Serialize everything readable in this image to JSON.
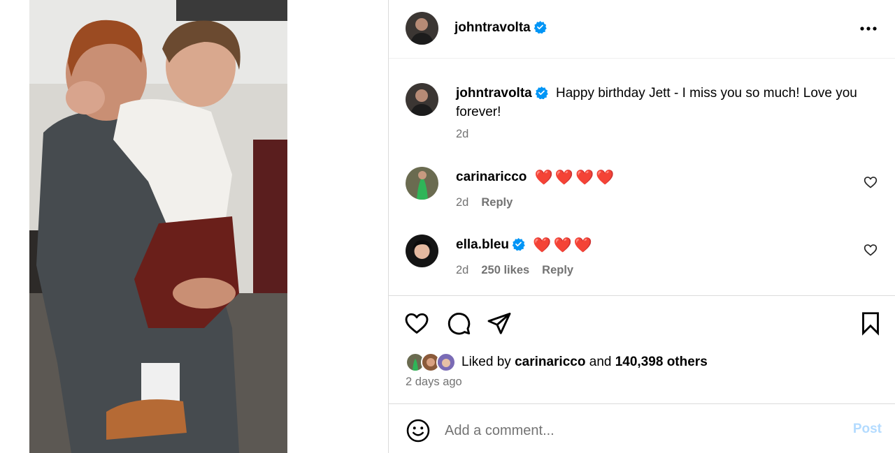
{
  "post": {
    "author": "johntravolta",
    "caption": "Happy birthday Jett - I miss you so much! Love you forever!",
    "time": "2d"
  },
  "comments": [
    {
      "username": "carinaricco",
      "text": "❤️❤️❤️❤️",
      "time": "2d",
      "likes": "",
      "reply": "Reply",
      "verified": false
    },
    {
      "username": "ella.bleu",
      "text": "❤️❤️❤️",
      "time": "2d",
      "likes": "250 likes",
      "reply": "Reply",
      "verified": true
    }
  ],
  "likes": {
    "prefix": "Liked by",
    "user": "carinaricco",
    "and": "and",
    "others": "140,398 others"
  },
  "date_label": "2 days ago",
  "composer": {
    "placeholder": "Add a comment...",
    "post_label": "Post"
  },
  "colors": {
    "verified": "#0095f6",
    "post_disabled": "#b3dbff",
    "meta": "#737373",
    "heart_emoji": "#e0182f"
  },
  "icons": [
    "verified-badge-icon",
    "more-options-icon",
    "heart-icon",
    "comment-icon",
    "share-icon",
    "bookmark-icon",
    "emoji-icon"
  ]
}
